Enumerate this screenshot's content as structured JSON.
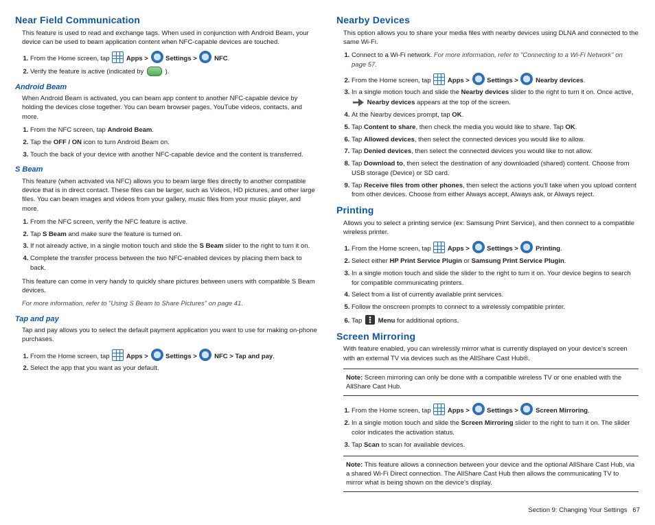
{
  "left": {
    "nfc": {
      "title": "Near Field Communication",
      "intro": "This feature is used to read and exchange tags. When used in conjunction with Android Beam, your device can be used to beam application content when NFC-capable devices are touched.",
      "s1a": "From the Home screen, tap ",
      "s1_apps": "Apps > ",
      "s1_settings": "Settings > ",
      "s1_nfc": "NFC",
      "s2a": "Verify the feature is active (indicated by ",
      "s2b": ")."
    },
    "abeam": {
      "title": "Android Beam",
      "intro": "When Android Beam is activated, you can beam app content to another NFC-capable device by holding the devices close together. You can beam browser pages, YouTube videos, contacts, and more.",
      "s1a": "From the NFC screen, tap ",
      "s1b": "Android Beam",
      "s2a": "Tap the ",
      "s2b": "OFF / ON",
      "s2c": " icon to turn Android Beam on.",
      "s3": "Touch the back of your device with another NFC-capable device and the content is transferred."
    },
    "sbeam": {
      "title": "S Beam",
      "intro": "This feature (when activated via NFC) allows you to beam large files directly to another compatible device that is in direct contact. These files can be larger, such as Videos, HD pictures, and other large files. You can beam images and videos from your gallery, music files from your music player, and more.",
      "s1": "From the NFC screen, verify the NFC feature is active.",
      "s2a": "Tap ",
      "s2b": "S Beam",
      "s2c": " and make sure the feature is turned on.",
      "s3a": "If not already active, in a single motion touch and slide the ",
      "s3b": "S Beam",
      "s3c": " slider to the right to turn it on.",
      "s4": "Complete the transfer process between the two NFC-enabled devices by placing them back to back.",
      "tail": "This feature can come in very handy to quickly share pictures between users with compatible S Beam devices.",
      "ref": "For more information, refer to \"Using S Beam to Share Pictures\" on page 41."
    },
    "tap": {
      "title": "Tap and pay",
      "intro": "Tap and pay allows you to select the default payment application you want to use for making on-phone purchases.",
      "s1a": "From the Home screen, tap ",
      "s1_apps": "Apps > ",
      "s1_settings": "Settings > ",
      "s1_nfc": "NFC > Tap and pay",
      "s2": "Select the app that you want as your default."
    }
  },
  "right": {
    "nearby": {
      "title": "Nearby Devices",
      "intro": "This option allows you to share your media files with nearby devices using DLNA and connected to the same Wi-Fi.",
      "s1a": "Connect to a Wi-Fi network. ",
      "s1ref": "For more information, refer to \"Connecting to a Wi-Fi Network\" on page 57.",
      "s2a": "From the Home screen, tap ",
      "s2_apps": "Apps > ",
      "s2_settings": "Settings > ",
      "s2_nearby": "Nearby devices",
      "s3a": "In a single motion touch and slide the ",
      "s3b": "Nearby devices",
      "s3c": " slider to the right to turn it on. Once active, ",
      "s3d": "Nearby devices",
      "s3e": " appears at the top of the screen.",
      "s4a": "At the Nearby devices prompt, tap ",
      "s4b": "OK",
      "s5a": "Tap ",
      "s5b": "Content to share",
      "s5c": ", then check the media you would like to share. Tap ",
      "s5d": "OK",
      "s6a": "Tap ",
      "s6b": "Allowed devices",
      "s6c": ", then select the connected devices you would like to allow.",
      "s7a": "Tap ",
      "s7b": "Denied devices",
      "s7c": ", then select the connected devices you would like to not allow.",
      "s8a": "Tap ",
      "s8b": "Download to",
      "s8c": ", then select the destination of any downloaded (shared) content. Choose from USB storage (Device) or SD card.",
      "s9a": "Tap ",
      "s9b": "Receive files from other phones",
      "s9c": ", then select the actions you'll take when you upload content from other devices. Choose from either Always accept, Always ask, or Always reject."
    },
    "printing": {
      "title": "Printing",
      "intro": "Allows you to select a printing service (ex: Samsung Print Service), and then connect to a compatible wireless printer.",
      "s1a": "From the Home screen, tap ",
      "s1_apps": "Apps > ",
      "s1_settings": "Settings > ",
      "s1_print": "Printing",
      "s2a": "Select either ",
      "s2b": "HP Print Service Plugin",
      "s2c": " or ",
      "s2d": "Samsung Print Service Plugin",
      "s3": "In a single motion touch and slide the slider to the right to turn it on. Your device begins to search for compatible communicating printers.",
      "s4": "Select from a list of currently available print services.",
      "s5": "Follow the onscreen prompts to connect to a wirelessly compatible printer.",
      "s6a": "Tap ",
      "s6b": "Menu",
      "s6c": " for additional options."
    },
    "mirror": {
      "title": "Screen Mirroring",
      "intro": "With feature enabled, you can wirelessly mirror what is currently displayed on your device's screen with an external TV via devices such as the AllShare Cast Hub®.",
      "note_label": "Note:",
      "note1": "Screen mirroring can only be done with a compatible wireless TV or one enabled with the AllShare Cast Hub.",
      "s1a": "From the Home screen, tap ",
      "s1_apps": "Apps > ",
      "s1_settings": "Settings > ",
      "s1_mirror": "Screen Mirroring",
      "s2a": "In a single motion touch and slide the ",
      "s2b": "Screen Mirroring",
      "s2c": " slider to the right to turn it on. The slider color indicates the activation status.",
      "s3a": "Tap ",
      "s3b": "Scan",
      "s3c": " to scan for available devices.",
      "note2": "This feature allows a connection between your device and the optional AllShare Cast Hub, via a shared Wi-Fi Direct connection. The AllShare Cast Hub then allows the communicating TV to mirror what is being shown on the device's display."
    }
  },
  "footer": {
    "section": "Section 9:  Changing Your Settings",
    "page": "67"
  }
}
